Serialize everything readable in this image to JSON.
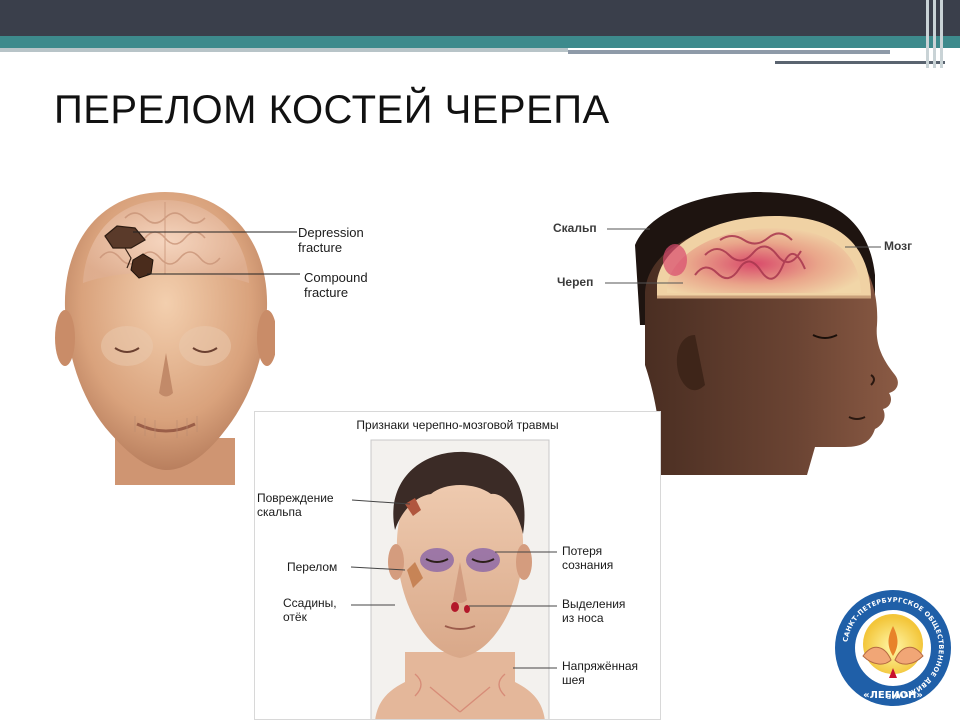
{
  "slide": {
    "title": "ПЕРЕЛОМ КОСТЕЙ ЧЕРЕПА"
  },
  "skull_image": {
    "labels": {
      "depression_1": "Depression",
      "depression_2": "fracture",
      "compound_1": "Compound",
      "compound_2": "fracture"
    }
  },
  "profile_image": {
    "labels": {
      "scalp": "Скальп",
      "skull": "Череп",
      "brain": "Мозг"
    }
  },
  "signs_image": {
    "title": "Признаки черепно-мозговой травмы",
    "labels": {
      "scalp_damage_1": "Повреждение",
      "scalp_damage_2": "скальпа",
      "fracture": "Перелом",
      "abrasions_1": "Ссадины,",
      "abrasions_2": "отёк",
      "consciousness_1": "Потеря",
      "consciousness_2": "сознания",
      "nose_1": "Выделения",
      "nose_2": "из носа",
      "neck_1": "Напряжённая",
      "neck_2": "шея"
    }
  },
  "logo": {
    "ring_text": "САНКТ-ПЕТЕРБУРГСКОЕ ОБЩЕСТВЕННОЕ ДВИЖЕНИЕ",
    "name": "«ЛЕГИОН»"
  },
  "colors": {
    "header_dark": "#3a3f4b",
    "header_teal": "#3d8a8c",
    "logo_blue": "#1f5fa8"
  }
}
